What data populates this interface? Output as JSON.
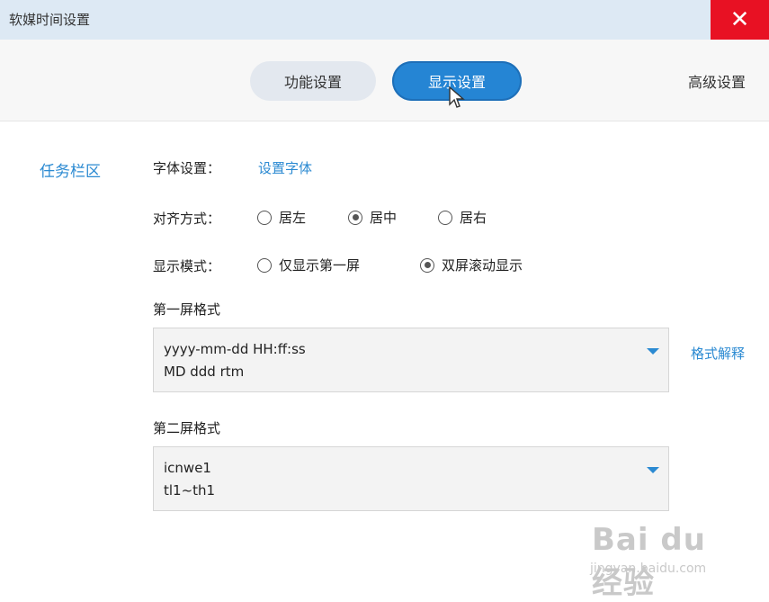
{
  "window": {
    "title": "软媒时间设置"
  },
  "tabs": {
    "function": "功能设置",
    "display": "显示设置",
    "advanced": "高级设置"
  },
  "sidebar": {
    "section": "任务栏区"
  },
  "font": {
    "label": "字体设置：",
    "link": "设置字体"
  },
  "align": {
    "label": "对齐方式：",
    "options": [
      "居左",
      "居中",
      "居右"
    ],
    "selected": "居中"
  },
  "mode": {
    "label": "显示模式：",
    "options": [
      "仅显示第一屏",
      "双屏滚动显示"
    ],
    "selected": "双屏滚动显示"
  },
  "screen1": {
    "label": "第一屏格式",
    "line1": "yyyy-mm-dd  HH:ff:ss",
    "line2": "MD ddd rtm",
    "help_link": "格式解释"
  },
  "screen2": {
    "label": "第二屏格式",
    "line1": "icnwe1",
    "line2": "tl1~th1"
  },
  "watermark": {
    "logo": "Bai du经验",
    "url": "jingyan.baidu.com"
  },
  "colors": {
    "accent": "#2585d4",
    "close": "#e81123",
    "titlebar": "#dde9f4"
  }
}
